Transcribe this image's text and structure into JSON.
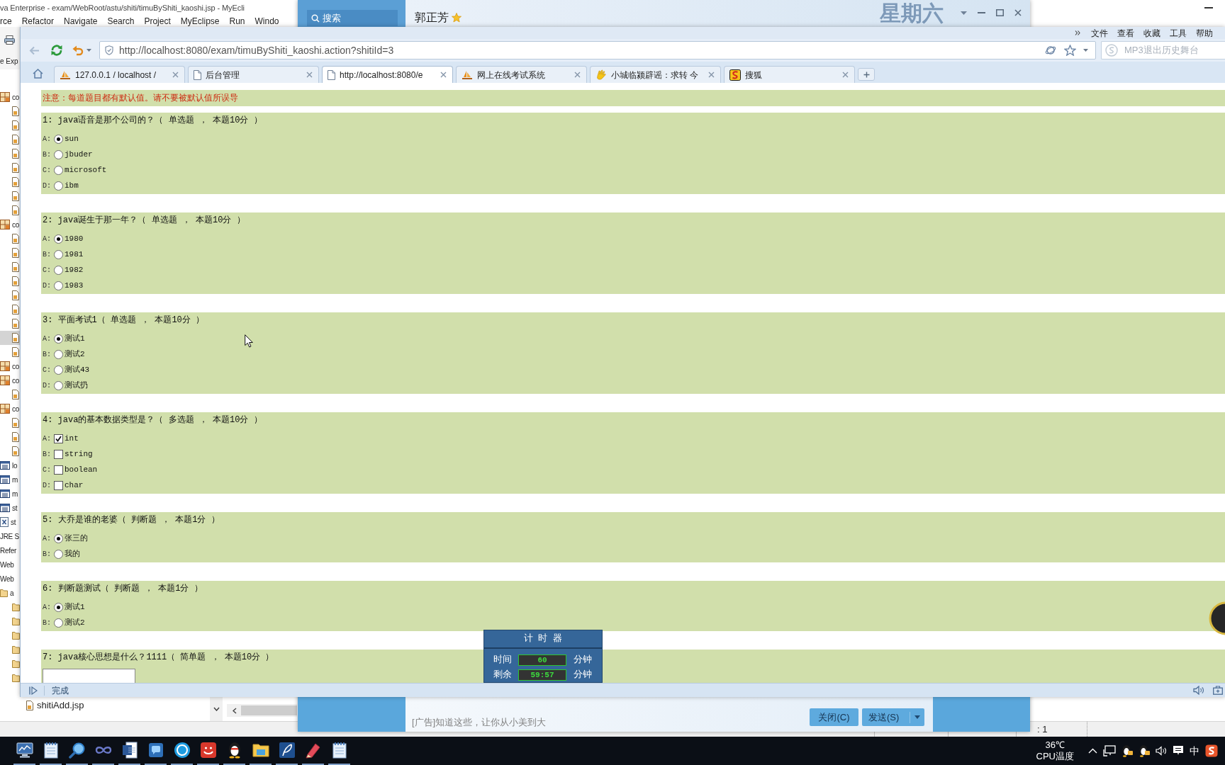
{
  "ide_window": {
    "title": "va Enterprise - exam/WebRoot/astu/shiti/timuByShiti_kaoshi.jsp - MyEcli",
    "menu": [
      "rce",
      "Refactor",
      "Navigate",
      "Search",
      "Project",
      "MyEclipse",
      "Run",
      "Windo"
    ],
    "explorer_tab": "e Exp",
    "tree": [
      {
        "kind": "package",
        "label": "co",
        "selected": false,
        "children": [
          {
            "kind": "file",
            "selected": false
          },
          {
            "kind": "file",
            "selected": false
          },
          {
            "kind": "file",
            "selected": false
          },
          {
            "kind": "file",
            "selected": false
          },
          {
            "kind": "file",
            "selected": false
          },
          {
            "kind": "file",
            "selected": false
          },
          {
            "kind": "file",
            "selected": false
          },
          {
            "kind": "file",
            "selected": false
          }
        ]
      },
      {
        "kind": "package",
        "label": "co",
        "selected": false,
        "children": [
          {
            "kind": "file",
            "selected": false
          },
          {
            "kind": "file",
            "selected": false
          },
          {
            "kind": "file",
            "selected": false
          },
          {
            "kind": "file",
            "selected": false
          },
          {
            "kind": "file",
            "selected": false
          },
          {
            "kind": "file",
            "selected": false
          },
          {
            "kind": "file",
            "selected": false
          },
          {
            "kind": "file",
            "selected": true
          },
          {
            "kind": "file",
            "selected": false
          }
        ]
      },
      {
        "kind": "package",
        "label": "co",
        "selected": false
      },
      {
        "kind": "package",
        "label": "co",
        "selected": false,
        "children": [
          {
            "kind": "file",
            "selected": false
          }
        ]
      },
      {
        "kind": "package",
        "label": "co",
        "selected": false,
        "children": [
          {
            "kind": "file",
            "selected": false
          },
          {
            "kind": "file",
            "selected": false
          },
          {
            "kind": "file",
            "selected": false
          }
        ]
      },
      {
        "kind": "table",
        "label": "lo",
        "selected": false
      },
      {
        "kind": "table",
        "label": "m",
        "selected": false
      },
      {
        "kind": "table",
        "label": "m",
        "selected": false
      },
      {
        "kind": "table",
        "label": "st",
        "selected": false
      },
      {
        "kind": "sheet",
        "label": "st",
        "selected": false
      },
      {
        "kind": "text",
        "label": "JRE S",
        "selected": false
      },
      {
        "kind": "text",
        "label": "Refer",
        "selected": false
      },
      {
        "kind": "text",
        "label": "Web",
        "selected": false
      },
      {
        "kind": "text",
        "label": "Web",
        "selected": false
      },
      {
        "kind": "folder",
        "label": "a",
        "selected": false,
        "children": [
          {
            "kind": "folder",
            "selected": false
          },
          {
            "kind": "folder",
            "selected": false
          },
          {
            "kind": "folder",
            "selected": false
          },
          {
            "kind": "folder",
            "selected": false
          },
          {
            "kind": "folder",
            "selected": false
          },
          {
            "kind": "folder",
            "selected": false
          }
        ]
      }
    ],
    "files": [
      "shitiAdd.jsp"
    ],
    "status": ": 1"
  },
  "chat_window": {
    "search_placeholder": "搜索",
    "contact": "郭正芳",
    "day": "星期六",
    "ad": "[广告]知道这些，让你从小美到大",
    "buttons": [
      {
        "label": "关闭(C)",
        "kind": "plain"
      },
      {
        "label": "发送(S)",
        "kind": "split"
      }
    ]
  },
  "browser": {
    "menu": [
      "文件",
      "查看",
      "收藏",
      "工具",
      "帮助"
    ],
    "back_disabled": true,
    "url": "http://localhost:8080/exam/timuByShiti_kaoshi.action?shitiId=3",
    "search_placeholder": "MP3退出历史舞台",
    "tabs": [
      {
        "kind": "pma",
        "label": "127.0.0.1 / localhost /",
        "selected": false
      },
      {
        "kind": "page",
        "label": "后台管理",
        "selected": false
      },
      {
        "kind": "page",
        "label": "http://localhost:8080/e",
        "selected": true
      },
      {
        "kind": "pma",
        "label": "网上在线考试系统",
        "selected": false
      },
      {
        "kind": "news",
        "label": "小城临颍辟谣：求转 今",
        "selected": false
      },
      {
        "kind": "portal",
        "label": "搜狐",
        "selected": false
      }
    ],
    "status": "完成"
  },
  "exam": {
    "notice": "注意：每道题目都有默认值。请不要被默认值所误导",
    "questions": [
      {
        "kind": "single",
        "title": "1: java语音是那个公司的？（ 单选题 ， 本题10分 ）",
        "options": [
          {
            "letter": "A:",
            "label": "sun",
            "selected": true
          },
          {
            "letter": "B:",
            "label": "jbuder",
            "selected": false
          },
          {
            "letter": "C:",
            "label": "microsoft",
            "selected": false
          },
          {
            "letter": "D:",
            "label": "ibm",
            "selected": false
          }
        ]
      },
      {
        "kind": "single",
        "title": "2: java诞生于那一年？（ 单选题 ， 本题10分 ）",
        "options": [
          {
            "letter": "A:",
            "label": "1980",
            "selected": true
          },
          {
            "letter": "B:",
            "label": "1981",
            "selected": false
          },
          {
            "letter": "C:",
            "label": "1982",
            "selected": false
          },
          {
            "letter": "D:",
            "label": "1983",
            "selected": false
          }
        ]
      },
      {
        "kind": "single",
        "title": "3: 平面考试1（ 单选题 ， 本题10分 ）",
        "options": [
          {
            "letter": "A:",
            "label": "测试1",
            "selected": true
          },
          {
            "letter": "B:",
            "label": "测试2",
            "selected": false
          },
          {
            "letter": "C:",
            "label": "测试43",
            "selected": false
          },
          {
            "letter": "D:",
            "label": "测试扔",
            "selected": false
          }
        ]
      },
      {
        "kind": "multiple",
        "title": "4: java的基本数据类型是？（ 多选题 ， 本题10分 ）",
        "options": [
          {
            "letter": "A:",
            "label": "int",
            "checked": true
          },
          {
            "letter": "B:",
            "label": "string",
            "checked": false
          },
          {
            "letter": "C:",
            "label": "boolean",
            "checked": false
          },
          {
            "letter": "D:",
            "label": "char",
            "checked": false
          }
        ]
      },
      {
        "kind": "single",
        "title": "5: 大乔是谁的老婆（ 判断题 ， 本题1分 ）",
        "options": [
          {
            "letter": "A:",
            "label": "张三的",
            "selected": true
          },
          {
            "letter": "B:",
            "label": "我的",
            "selected": false
          }
        ]
      },
      {
        "kind": "single",
        "title": "6: 判断题测试（ 判断题 ， 本题1分 ）",
        "options": [
          {
            "letter": "A:",
            "label": "测试1",
            "selected": true
          },
          {
            "letter": "B:",
            "label": "测试2",
            "selected": false
          }
        ]
      },
      {
        "kind": "text",
        "title": "7: java核心思想是什么？1111（ 简单题 ， 本题10分 ）"
      }
    ],
    "timer": {
      "title": "计 时 器",
      "rows": [
        {
          "label": "时间",
          "value": "60",
          "unit": "分钟"
        },
        {
          "label": "剩余",
          "value": "59:57",
          "unit": "分钟"
        }
      ]
    }
  },
  "taskbar": {
    "temperature": "36℃",
    "temperature_label": "CPU温度",
    "input_method": "中"
  }
}
